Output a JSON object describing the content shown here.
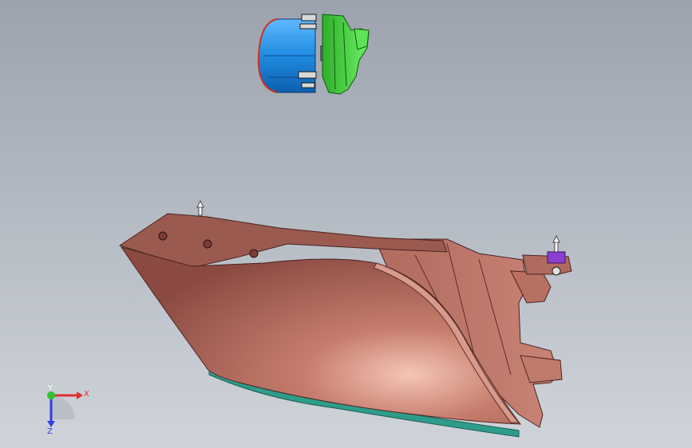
{
  "viewport": {
    "colors": {
      "bg_top": "#9ca3ae",
      "bg_bottom": "#d0d4da",
      "housing": "#a86458",
      "lens_teal": "#2e9c8a",
      "foglamp_blue": "#1e8be0",
      "foglamp_green": "#3fd43a",
      "clip_purple": "#8a3fd0"
    }
  },
  "triad": {
    "x_label": "X",
    "y_label": "Y",
    "z_label": "Z",
    "x_color": "#e03030",
    "y_color": "#30c030",
    "z_color": "#3040e0"
  }
}
